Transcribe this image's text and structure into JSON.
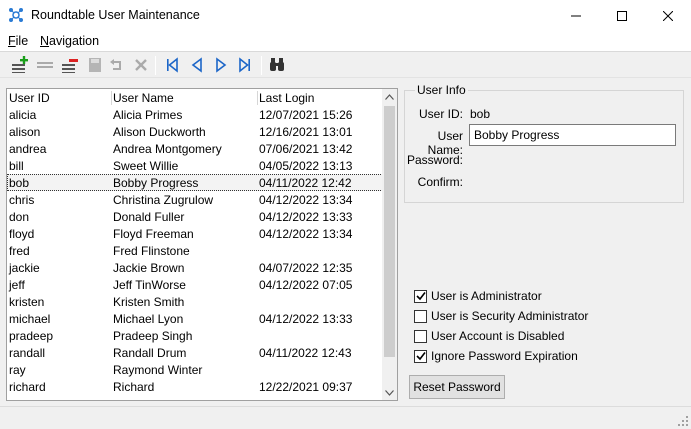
{
  "window": {
    "title": "Roundtable User Maintenance"
  },
  "menu": [
    "File",
    "Navigation"
  ],
  "toolbar": {
    "buttons": [
      "add-user",
      "insert-row",
      "delete-row",
      "save",
      "undo",
      "cancel",
      "first-record",
      "previous-record",
      "next-record",
      "last-record",
      "find"
    ]
  },
  "table": {
    "columns": [
      "User ID",
      "User Name",
      "Last Login"
    ],
    "selected_index": 4,
    "rows": [
      [
        "alicia",
        "Alicia Primes",
        "12/07/2021 15:26"
      ],
      [
        "alison",
        "Alison Duckworth",
        "12/16/2021 13:01"
      ],
      [
        "andrea",
        "Andrea Montgomery",
        "07/06/2021 13:42"
      ],
      [
        "bill",
        "Sweet Willie",
        "04/05/2022 13:13"
      ],
      [
        "bob",
        "Bobby Progress",
        "04/11/2022 12:42"
      ],
      [
        "chris",
        "Christina Zugrulow",
        "04/12/2022 13:34"
      ],
      [
        "don",
        "Donald Fuller",
        "04/12/2022 13:33"
      ],
      [
        "floyd",
        "Floyd Freeman",
        "04/12/2022 13:34"
      ],
      [
        "fred",
        "Fred Flinstone",
        ""
      ],
      [
        "jackie",
        "Jackie Brown",
        "04/07/2022 12:35"
      ],
      [
        "jeff",
        "Jeff TinWorse",
        "04/12/2022 07:05"
      ],
      [
        "kristen",
        "Kristen Smith",
        ""
      ],
      [
        "michael",
        "Michael Lyon",
        "04/12/2022 13:33"
      ],
      [
        "pradeep",
        "Pradeep Singh",
        ""
      ],
      [
        "randall",
        "Randall Drum",
        "04/11/2022 12:43"
      ],
      [
        "ray",
        "Raymond Winter",
        ""
      ],
      [
        "richard",
        "Richard",
        "12/22/2021 09:37"
      ]
    ]
  },
  "user_info": {
    "group_title": "User Info",
    "user_id_label": "User ID:",
    "user_id_value": "bob",
    "user_name_label": "User Name:",
    "user_name_value": "Bobby Progress",
    "password_label": "Password:",
    "confirm_label": "Confirm:"
  },
  "options": [
    {
      "label": "User is Administrator",
      "checked": true
    },
    {
      "label": "User is Security Administrator",
      "checked": false
    },
    {
      "label": "User Account is Disabled",
      "checked": false
    },
    {
      "label": "Ignore Password Expiration",
      "checked": true
    }
  ],
  "reset_button": "Reset Password"
}
